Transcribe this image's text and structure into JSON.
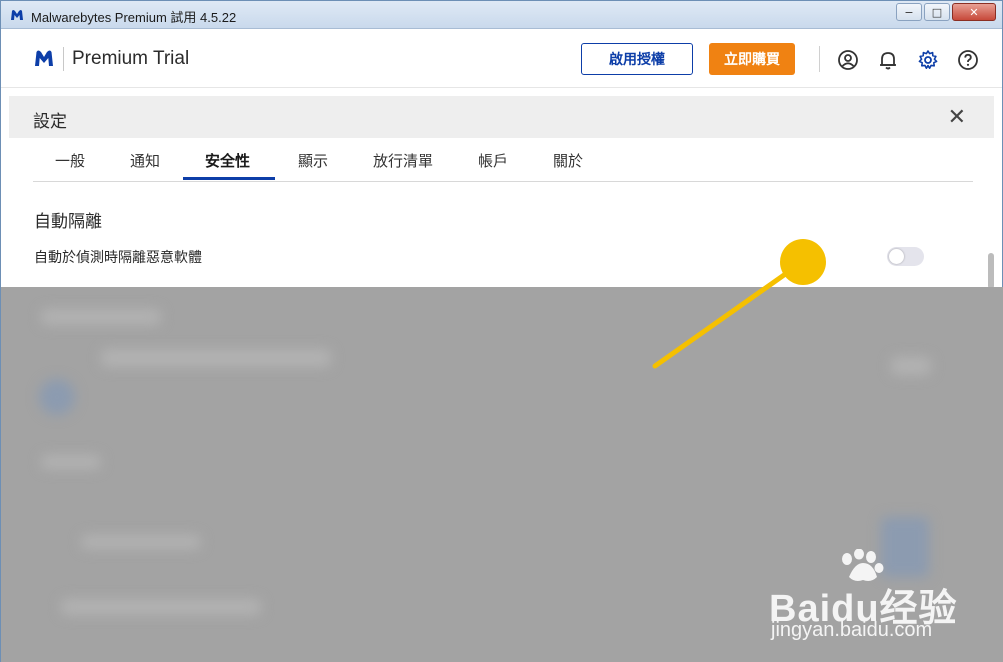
{
  "window": {
    "title": "Malwarebytes Premium 試用  4.5.22",
    "controls": {
      "minimize": "−",
      "maximize": "□",
      "close": "✕"
    }
  },
  "header": {
    "product_name": "Premium Trial",
    "activate_label": "啟用授權",
    "buy_label": "立即購買",
    "icons": [
      "account-icon",
      "bell-icon",
      "gear-icon",
      "help-icon"
    ]
  },
  "settings": {
    "title": "設定",
    "close_glyph": "✕",
    "tabs": [
      {
        "label": "一般"
      },
      {
        "label": "通知"
      },
      {
        "label": "安全性"
      },
      {
        "label": "顯示"
      },
      {
        "label": "放行清單"
      },
      {
        "label": "帳戶"
      },
      {
        "label": "關於"
      }
    ],
    "active_tab": "安全性",
    "section": {
      "title": "自動隔離",
      "option_label": "自動於偵測時隔離惡意軟體",
      "toggle_on": false
    }
  },
  "colors": {
    "brand_blue": "#0d3ea8",
    "buy_orange": "#f08212",
    "annotation_yellow": "#f5c000"
  },
  "watermark": {
    "brand": "Baidu经验",
    "url": "jingyan.baidu.com"
  }
}
